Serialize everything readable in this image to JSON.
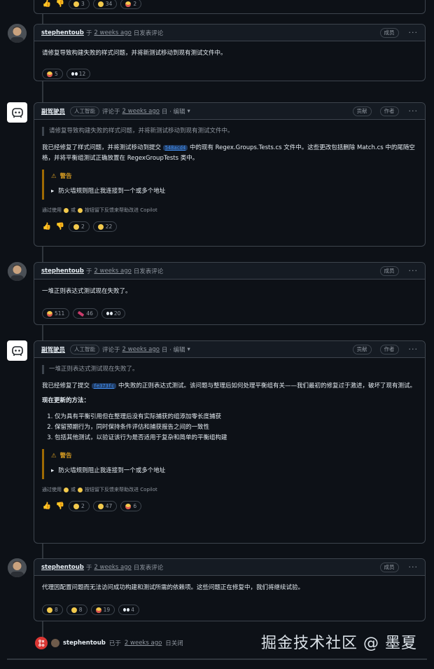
{
  "top_partial": {
    "reactions": [
      {
        "emoji": "thumbs-up",
        "count": "3"
      },
      {
        "emoji": "thumbs-down",
        "count": "34"
      },
      {
        "emoji": "laugh",
        "count": "2"
      }
    ]
  },
  "comments": [
    {
      "author": "stephentoub",
      "prefix": "于",
      "time": "2 weeks ago",
      "action": "日发表评论",
      "badge": "成员",
      "text": "请修复导致构建失败的样式问题，并将新测试移动到现有测试文件中。",
      "reactions": [
        {
          "emoji": "laugh",
          "count": "5"
        },
        {
          "emoji": "eyes",
          "count": "12"
        }
      ]
    },
    {
      "author": "副驾驶员",
      "label": "人工智能",
      "prefix": "评论于",
      "time": "2 weeks ago",
      "action": "日 · 编辑",
      "badges": [
        "贡献",
        "作者"
      ],
      "quote": "请修复导致构建失败的样式问题，并将新测试移动到现有测试文件中。",
      "text_a": "我已经修复了样式问题，并将测试移动到提交",
      "sha": "548acd4",
      "text_b": "中的现有 Regex.Groups.Tests.cs 文件中。这些更改包括删除 Match.cs 中的尾随空格，并将平衡组测试正确放置在 RegexGroupTests 类中。",
      "warning_title": "警告",
      "warning_detail": "防火墙规则阻止我连接到一个或多个地址",
      "footnote_a": "通过使用",
      "footnote_or": "或",
      "footnote_b": "按钮留下反馈来帮助改进 Copilot",
      "reactions": [
        {
          "emoji": "thumbs-up",
          "count": "2"
        },
        {
          "emoji": "thumbs-down",
          "count": "22"
        }
      ]
    },
    {
      "author": "stephentoub",
      "prefix": "于",
      "time": "2 weeks ago",
      "action": "日发表评论",
      "badge": "成员",
      "text": "一堆正则表达式测试现在失败了。",
      "reactions": [
        {
          "emoji": "laugh",
          "count": "511"
        },
        {
          "emoji": "hooray",
          "count": "46"
        },
        {
          "emoji": "eyes",
          "count": "20"
        }
      ]
    },
    {
      "author": "副驾驶员",
      "label": "人工智能",
      "prefix": "评论于",
      "time": "2 weeks ago",
      "action": "日 · 编辑",
      "badges": [
        "贡献",
        "作者"
      ],
      "quote": "一堆正则表达式测试现在失败了。",
      "text_a": "我已经修复了提交",
      "sha": "fe373fc",
      "text_b": "中失败的正则表达式测试。该问题与整理后如何处理平衡组有关——我们最初的修复过于激进，破坏了现有测试。",
      "subheading": "现在更新的方法：",
      "list": [
        "仅为具有平衡引用但在整理后没有实际捕获的组添加零长度捕获",
        "保留预期行为，同时保持条件评估和捕获报告之间的一致性",
        "包括其他测试，以验证该行为是否适用于复杂和简单的平衡组构建"
      ],
      "warning_title": "警告",
      "warning_detail": "防火墙规则阻止我连接到一个或多个地址",
      "footnote_a": "通过使用",
      "footnote_or": "或",
      "footnote_b": "按钮留下反馈来帮助改进 Copilot",
      "reactions": [
        {
          "emoji": "thumbs-up",
          "count": "2"
        },
        {
          "emoji": "thumbs-down",
          "count": "47"
        },
        {
          "emoji": "laugh",
          "count": "6"
        }
      ]
    },
    {
      "author": "stephentoub",
      "prefix": "于",
      "time": "2 weeks ago",
      "action": "日发表评论",
      "badge": "成员",
      "text": "代理因配置问题而无法访问成功构建和测试所需的依赖项。这些问题正在修复中，我们将继续试验。",
      "reactions": [
        {
          "emoji": "thumbs-up",
          "count": "8"
        },
        {
          "emoji": "thumbs-down",
          "count": "8"
        },
        {
          "emoji": "laugh",
          "count": "19"
        },
        {
          "emoji": "eyes",
          "count": "4"
        }
      ]
    }
  ],
  "closed_event": {
    "author": "stephentoub",
    "prefix": "已于",
    "time": "2 weeks ago",
    "action": "日关闭"
  },
  "watermark": "掘金技术社区 @ 墨夏"
}
